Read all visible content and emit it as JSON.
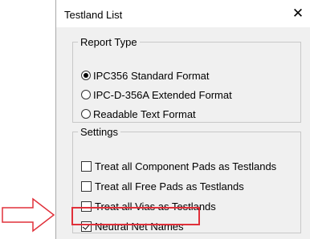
{
  "dialog": {
    "title": "Testland List",
    "close_label": "✕"
  },
  "report_type": {
    "legend": "Report Type",
    "options": [
      {
        "label": "IPC356 Standard Format",
        "checked": true
      },
      {
        "label": "IPC-D-356A Extended Format",
        "checked": false
      },
      {
        "label": "Readable Text Format",
        "checked": false
      }
    ]
  },
  "settings": {
    "legend": "Settings",
    "options": [
      {
        "label": "Treat all Component Pads as Testlands",
        "checked": false
      },
      {
        "label": "Treat all Free Pads as Testlands",
        "checked": false
      },
      {
        "label": "Treat all Vias as Testlands",
        "checked": false
      },
      {
        "label": "Neutral Net Names",
        "checked": true
      }
    ]
  },
  "annotation": {
    "arrow_color": "#e0303a",
    "highlight_color": "#e0303a"
  }
}
